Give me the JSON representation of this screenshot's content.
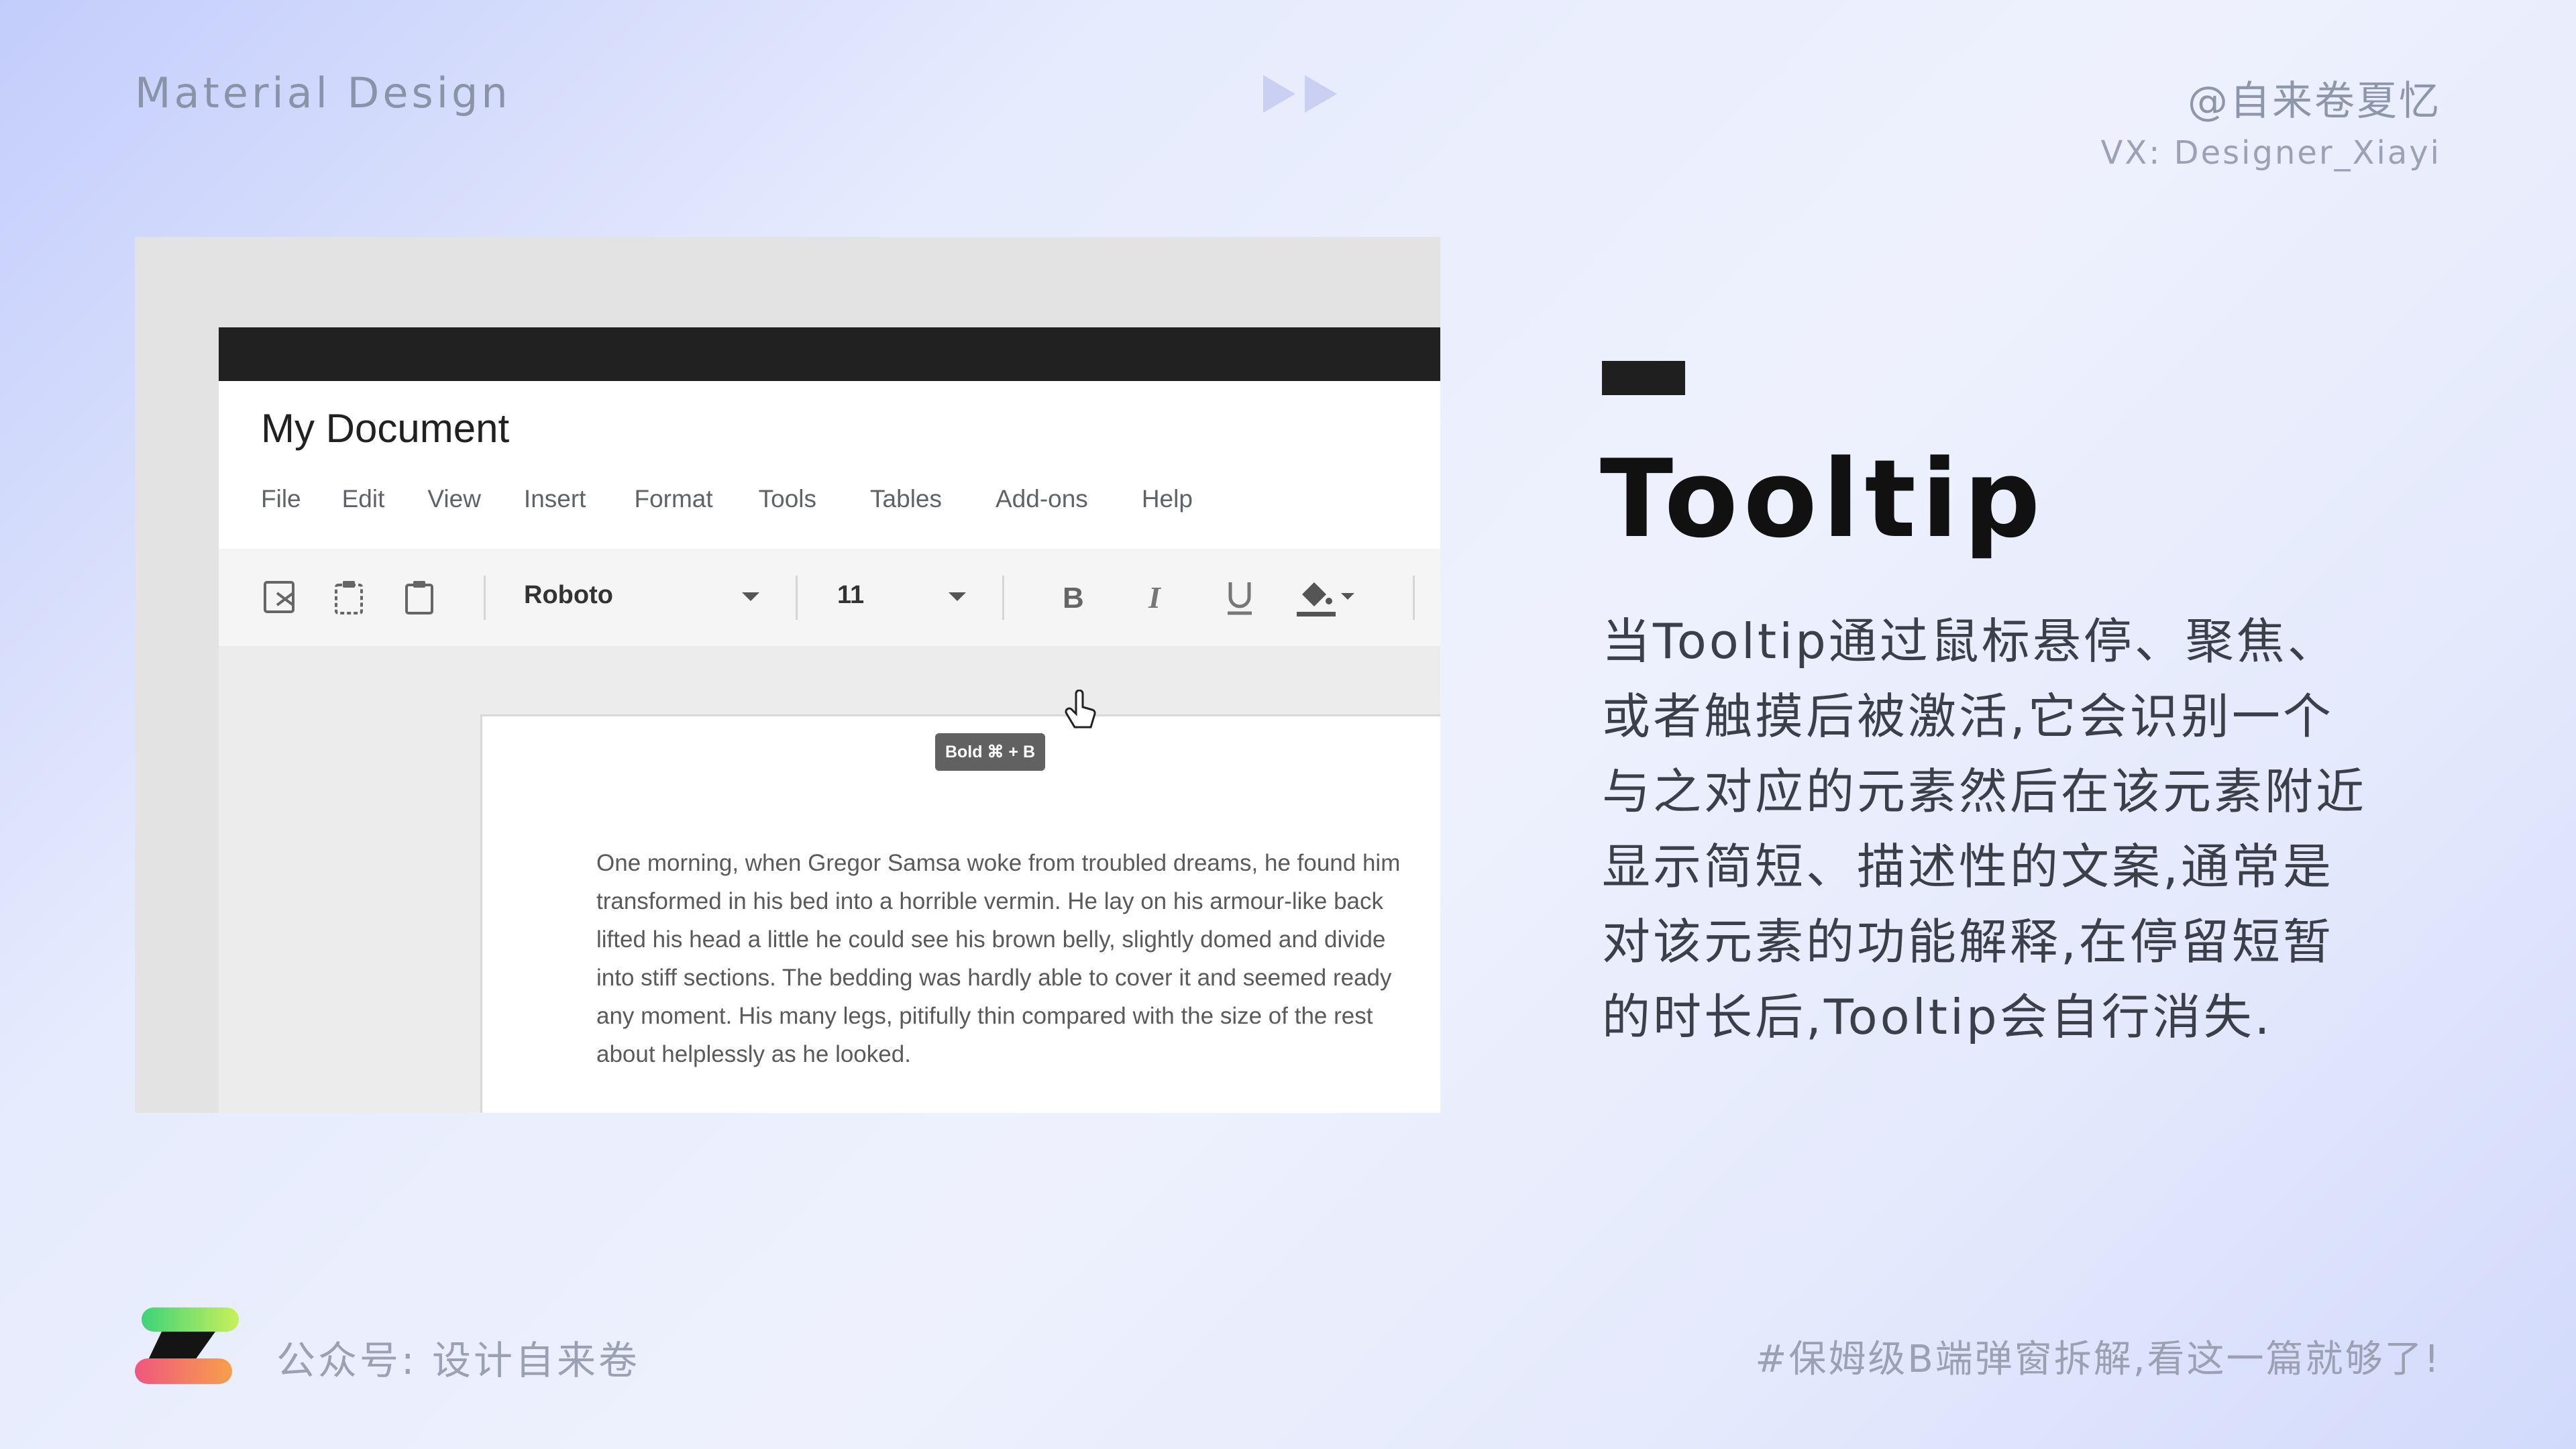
{
  "header": {
    "brand": "Material Design",
    "author": "@自来卷夏忆",
    "wechat": "VX: Designer_Xiayi"
  },
  "screenshot": {
    "doc_title": "My Document",
    "menu": [
      "File",
      "Edit",
      "View",
      "Insert",
      "Format",
      "Tools",
      "Tables",
      "Add-ons",
      "Help"
    ],
    "font_name": "Roboto",
    "font_size": "11",
    "tooltip": "Bold ⌘ + B",
    "body_lines": [
      "One morning, when Gregor Samsa woke from troubled dreams, he found him",
      "transformed in his bed into a horrible vermin. He lay on his armour-like back",
      "lifted his head a little he could see his brown belly, slightly domed and divide",
      "into stiff sections. The bedding was hardly able to cover it and seemed ready",
      "any moment. His many legs, pitifully thin compared with the size of the rest",
      "about helplessly as he looked."
    ]
  },
  "content": {
    "title": "Tooltip",
    "description": "当Tooltip通过鼠标悬停、聚焦、或者触摸后被激活,它会识别一个与之对应的元素然后在该元素附近显示简短、描述性的文案,通常是对该元素的功能解释,在停留短暂的时长后,Tooltip会自行消失."
  },
  "footer": {
    "account": "公众号: 设计自来卷",
    "tagline": "#保姆级B端弹窗拆解,看这一篇就够了!"
  },
  "colors": {
    "appbar": "#212121",
    "tooltip_bg": "#616161",
    "accent_bar": "#1f1f1f"
  },
  "icons": [
    "play-forward-icon",
    "cut-icon",
    "copy-icon",
    "paste-icon",
    "bold-icon",
    "italic-icon",
    "underline-icon",
    "fill-color-icon",
    "cursor-icon",
    "brand-logo"
  ]
}
